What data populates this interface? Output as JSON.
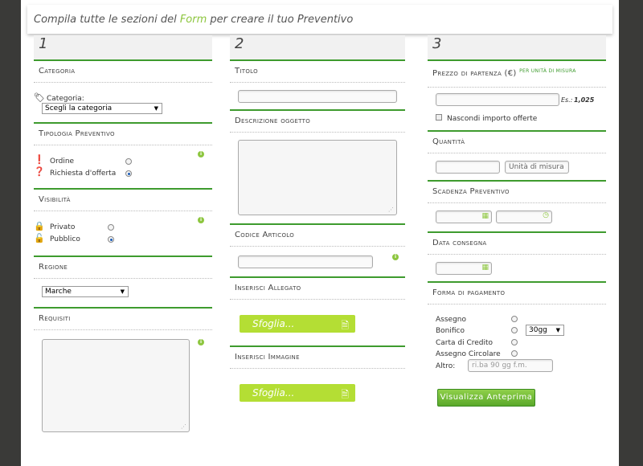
{
  "header": {
    "text_before": "Compila tutte le sezioni del ",
    "highlight": "Form",
    "text_after": " per creare il tuo Preventivo"
  },
  "col1": {
    "number": "1",
    "categoria": {
      "title": "Categoria",
      "label": "Categoria:",
      "select": "Scegli la categoria"
    },
    "tipologia": {
      "title": "Tipologia Preventivo",
      "options": [
        "Ordine",
        "Richiesta d'offerta"
      ],
      "selected": 1
    },
    "visibilita": {
      "title": "Visibilità",
      "options": [
        "Privato",
        "Pubblico"
      ],
      "selected": 1
    },
    "regione": {
      "title": "Regione",
      "select": "Marche"
    },
    "requisiti": {
      "title": "Requisiti"
    }
  },
  "col2": {
    "number": "2",
    "titolo": {
      "title": "Titolo"
    },
    "descrizione": {
      "title": "Descrizione oggetto"
    },
    "codice": {
      "title": "Codice Articolo"
    },
    "allegato": {
      "title": "Inserisci Allegato",
      "button": "Sfoglia..."
    },
    "immagine": {
      "title": "Inserisci Immagine",
      "button": "Sfoglia..."
    }
  },
  "col3": {
    "number": "3",
    "prezzo": {
      "title": "Prezzo di partenza (€)",
      "unit_note": "PER UNITÀ DI MISURA",
      "example_label": "Es.:",
      "example_value": "1,025",
      "hide_label": "Nascondi importo offerte"
    },
    "quantita": {
      "title": "Quantità",
      "unit_placeholder": "Unità di misura"
    },
    "scadenza": {
      "title": "Scadenza Preventivo"
    },
    "consegna": {
      "title": "Data consegna"
    },
    "pagamento": {
      "title": "Forma di pagamento",
      "options": [
        "Assegno",
        "Bonifico",
        "Carta di Credito",
        "Assegno Circolare"
      ],
      "bonifico_select": "30gg",
      "altro_label": "Altro:",
      "altro_placeholder": "ri.ba 90 gg f.m."
    },
    "preview_button": "Visualizza Anteprima"
  },
  "colors": {
    "accent_green": "#3e9b2e",
    "button_lime": "#b4de34",
    "highlight": "#8dc63f"
  }
}
